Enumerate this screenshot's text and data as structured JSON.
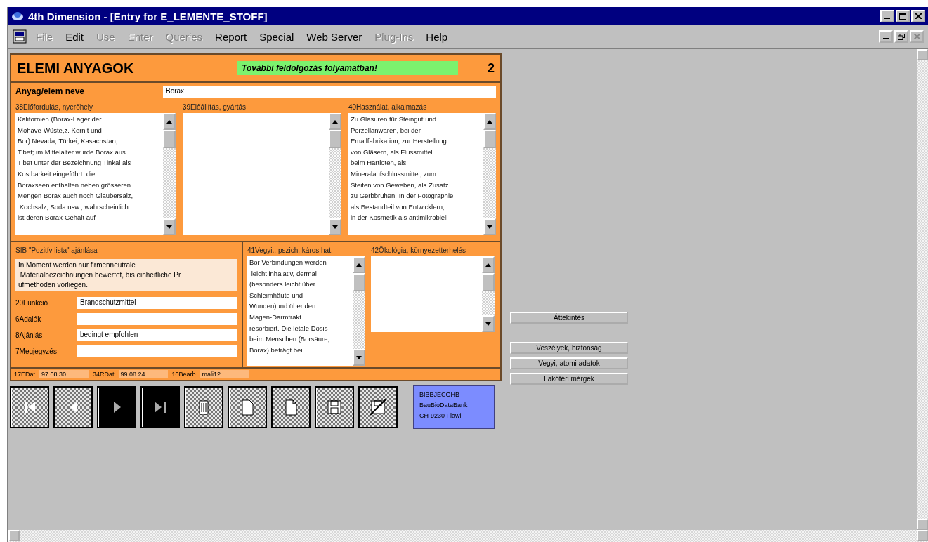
{
  "window": {
    "title": "4th Dimension - [Entry for E_LEMENTE_STOFF]"
  },
  "menu": [
    {
      "label": "File",
      "disabled": true
    },
    {
      "label": "Edit",
      "disabled": false
    },
    {
      "label": "Use",
      "disabled": true
    },
    {
      "label": "Enter",
      "disabled": true
    },
    {
      "label": "Queries",
      "disabled": true
    },
    {
      "label": "Report",
      "disabled": false
    },
    {
      "label": "Special",
      "disabled": false
    },
    {
      "label": "Web Server",
      "disabled": false
    },
    {
      "label": "Plug-Ins",
      "disabled": true
    },
    {
      "label": "Help",
      "disabled": false
    }
  ],
  "form": {
    "title": "ELEMI ANYAGOK",
    "status": "További feldolgozás folyamatban!",
    "page": "2",
    "name_field": {
      "label": "Anyag/elem neve",
      "value": "Borax"
    },
    "memos_top": [
      {
        "label": "38Előfordulás, nyerőhely",
        "value": "Kalifornien (Borax-Lager der\nMohave-Wüste,z. Kernit und\nBor).Nevada, Türkei, Kasachstan,\nTibet; im Mittelalter wurde Borax aus\nTibet unter der Bezeichnung Tinkal als\nKostbarkeit eingeführt. die\nBoraxseen enthalten neben grösseren\nMengen Borax auch noch Glaubersalz,\n Kochsalz, Soda usw., wahrscheinlich\nist deren Borax-Gehalt auf"
      },
      {
        "label": "39Előállítás, gyártás"
      },
      {
        "label": "40Használat, alkalmazás",
        "value": "Zu Glasuren für Steingut und\nPorzellanwaren, bei der\nEmailfabrikation, zur Herstellung\nvon Gläsern, als Flussmittel\nbeim Hartlöten, als\nMineralaufschlussmittel, zum\nSteifen von Geweben, als Zusatz\nzu Gerbbrühen. In der Fotographie\nals Bestandteil von Entwicklern,\nin der Kosmetik als antimikrobiell"
      }
    ],
    "sib": {
      "label": "SIB \"Pozitív lista\" ajánlása",
      "text": "In Moment werden nur firmenneutrale\n Materialbezeichnungen bewertet, bis einheitliche Pr\nüfmethoden vorliegen."
    },
    "fields": [
      {
        "label": "20Funkció",
        "value": "Brandschutzmittel"
      },
      {
        "label": "6Adalék"
      },
      {
        "label": "8Ajánlás",
        "value": "bedingt empfohlen"
      },
      {
        "label": "7Megjegyzés"
      }
    ],
    "memos_bottom": [
      {
        "label": "41Vegyi., pszich. káros hat.",
        "value": "Bor Verbindungen werden\n leicht inhalativ, dermal\n(besonders leicht über\nSchleimhäute und\nWunden)und über den\nMagen-Darmtrakt\nresorbiert. Die letale Dosis\nbeim Menschen (Borsäure,\nBorax) beträgt bei"
      },
      {
        "label": "42Ökológia, környezetterhelés"
      }
    ],
    "footer": [
      {
        "label": "17EDat",
        "value": "97.08.30"
      },
      {
        "label": "34RDat",
        "value": "99.08.24"
      },
      {
        "label": "10Bearb",
        "value": "mali12"
      }
    ]
  },
  "nav_buttons": [
    {
      "kind": "first",
      "inverted": false
    },
    {
      "kind": "previous",
      "inverted": false
    },
    {
      "kind": "next",
      "inverted": true
    },
    {
      "kind": "last",
      "inverted": true
    },
    {
      "kind": "delete",
      "inverted": false
    },
    {
      "kind": "new",
      "inverted": false
    },
    {
      "kind": "duplicate",
      "inverted": false
    },
    {
      "kind": "save",
      "inverted": false
    },
    {
      "kind": "cancel",
      "inverted": false
    }
  ],
  "publisher": "BIBBJECOHB\nBauBioDataBank\nCH-9230 Flawil",
  "overview_button": "Áttekintés",
  "section_buttons": [
    "Veszélyek, biztonság",
    "Vegyi, atomi adatok",
    "Lakótéri mérgek"
  ]
}
